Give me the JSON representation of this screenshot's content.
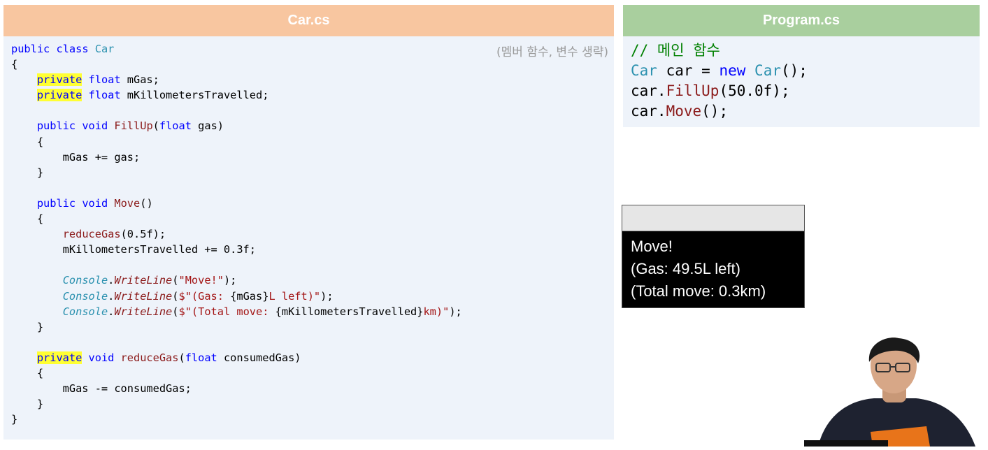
{
  "car_panel": {
    "title": "Car.cs",
    "note": "(멤버 함수, 변수 생략)"
  },
  "program_panel": {
    "title": "Program.cs"
  },
  "console": {
    "lines": [
      "Move!",
      "(Gas: 49.5L left)",
      "(Total move: 0.3km)"
    ]
  },
  "colors": {
    "car_header": "#f8c6a0",
    "program_header": "#a9cf9e",
    "panel_bg": "#eef3fa",
    "keyword": "#0000ff",
    "type": "#2b91af",
    "method": "#8b1a1a",
    "highlight": "#ffff33",
    "comment": "#008000"
  },
  "presenter": {
    "icon": "person-video-icon"
  }
}
